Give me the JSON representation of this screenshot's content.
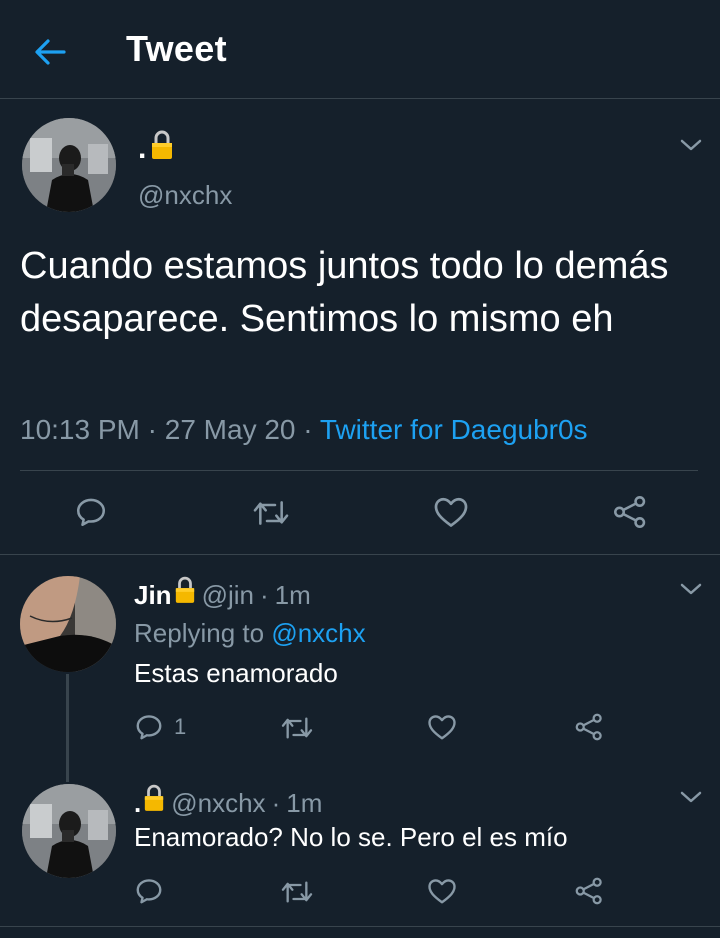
{
  "header": {
    "title": "Tweet"
  },
  "main_tweet": {
    "display_name": ".",
    "handle": "@nxchx",
    "text": "Cuando estamos juntos todo lo demás desaparece. Sentimos lo mismo eh",
    "time": "10:13 PM",
    "date": "27 May 20",
    "source": "Twitter for Daegubr0s",
    "separator": "·"
  },
  "replies": [
    {
      "display_name": "Jin",
      "handle": "@jin",
      "time": "1m",
      "replying_label": "Replying to",
      "replying_to": "@nxchx",
      "text": "Estas enamorado",
      "reply_count": "1"
    },
    {
      "display_name": ".",
      "handle": "@nxchx",
      "time": "1m",
      "text": "Enamorado? No lo se. Pero el es mío"
    }
  ],
  "separator": "·",
  "colors": {
    "background": "#15202b",
    "accent": "#1da1f2",
    "muted": "#8899a6",
    "border": "#38444d",
    "lock": "#f5b800"
  },
  "icons": [
    "back-arrow-icon",
    "lock-icon",
    "chevron-down-icon",
    "reply-icon",
    "retweet-icon",
    "like-icon",
    "share-icon"
  ]
}
